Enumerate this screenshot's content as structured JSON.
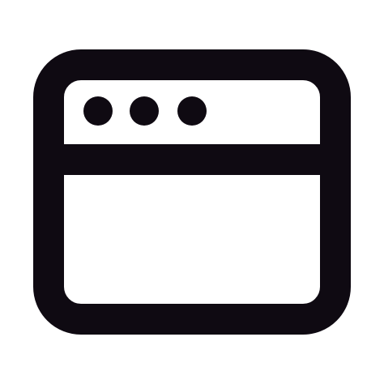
{
  "icon": {
    "name": "browser-window-icon",
    "stroke_color": "#0f0a12",
    "fill_color": "#ffffff"
  },
  "window": {
    "title_bar": {
      "dots": [
        "dot-1",
        "dot-2",
        "dot-3"
      ]
    }
  }
}
